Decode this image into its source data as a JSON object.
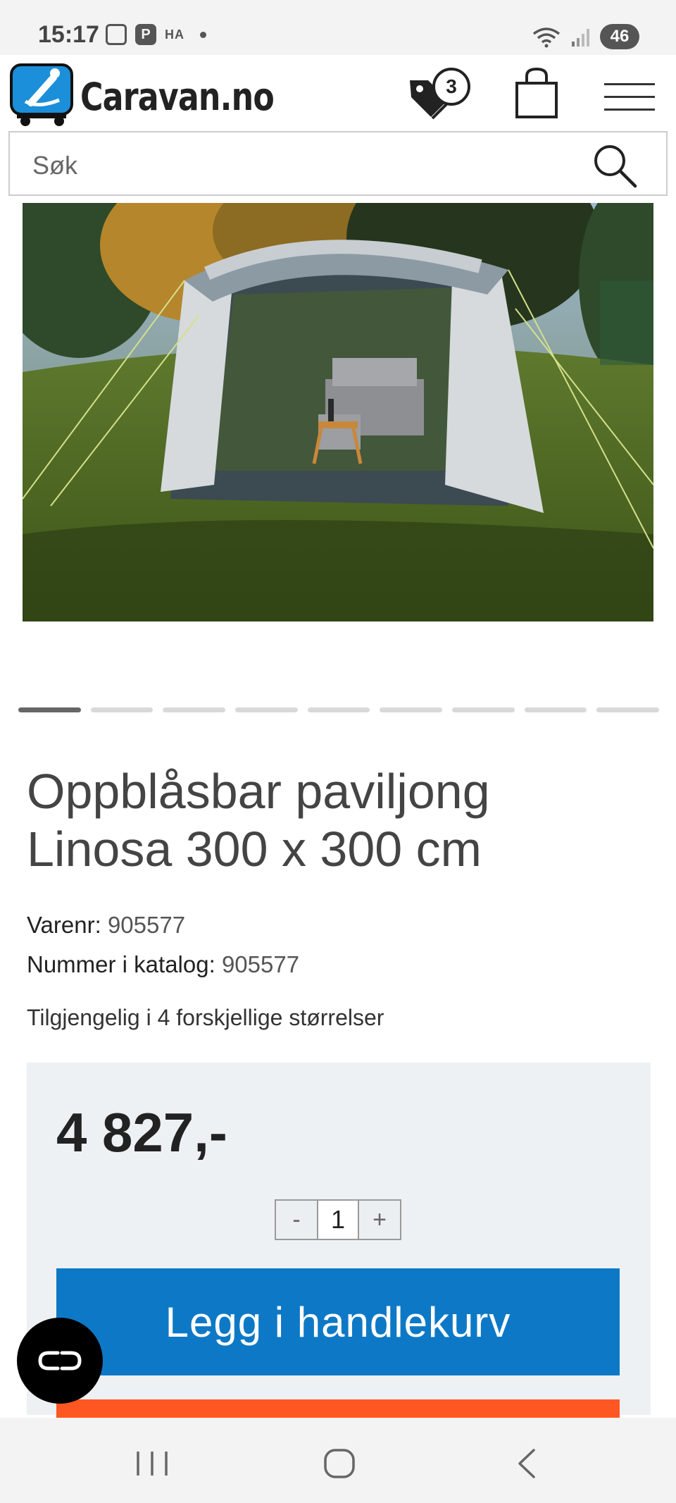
{
  "status_bar": {
    "time": "15:17",
    "indicator_text": "HA",
    "battery": "46"
  },
  "header": {
    "logo_text": "Caravan.no",
    "tag_count": "3"
  },
  "search": {
    "placeholder": "Søk"
  },
  "carousel": {
    "total": 9,
    "active_index": 0
  },
  "product": {
    "title": "Oppblåsbar paviljong Linosa 300 x 300 cm",
    "varenr_label": "Varenr:",
    "varenr_value": "905577",
    "catalog_label": "Nummer i katalog:",
    "catalog_value": "905577",
    "availability": "Tilgjengelig i 4 forskjellige størrelser"
  },
  "purchase": {
    "price": "4 827,-",
    "qty_minus": "-",
    "qty_value": "1",
    "qty_plus": "+",
    "add_to_cart_label": "Legg i handlekurv"
  },
  "colors": {
    "primary_button": "#0d79c6",
    "secondary_button": "#ff5722",
    "logo_blue": "#1b8fd9"
  },
  "icons": [
    "tag-icon",
    "shopping-bag-icon",
    "hamburger-menu-icon",
    "search-icon",
    "link-icon",
    "recents-icon",
    "home-icon",
    "back-icon"
  ]
}
